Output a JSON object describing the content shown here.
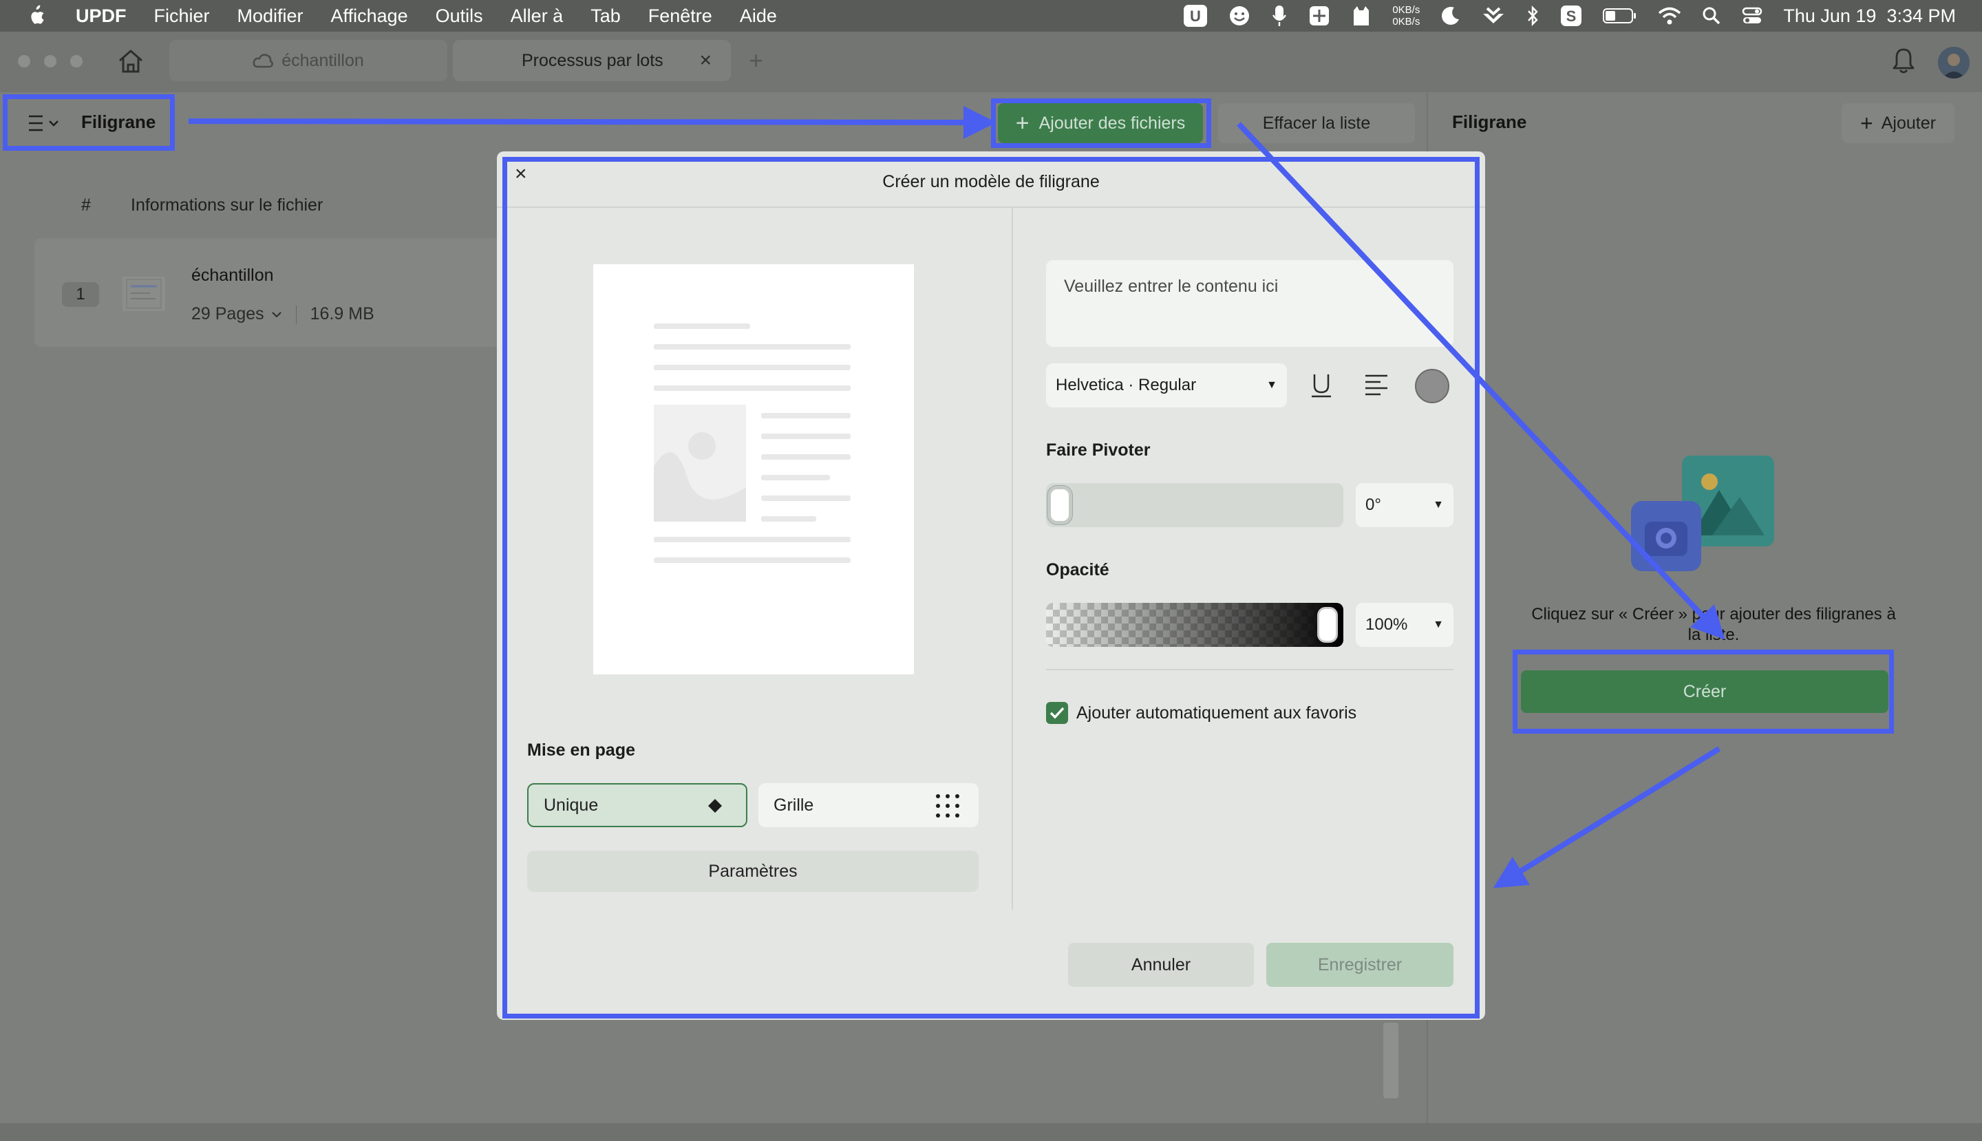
{
  "menubar": {
    "apple_icon": "apple-icon",
    "app_name": "UPDF",
    "items": [
      "Fichier",
      "Modifier",
      "Affichage",
      "Outils",
      "Aller à",
      "Tab",
      "Fenêtre",
      "Aide"
    ],
    "net_up": "0KB/s",
    "net_down": "0KB/s",
    "datetime": "Thu Jun 19  3:34 PM"
  },
  "tabs": {
    "doc_tab": "échantillon",
    "batch_tab": "Processus par lots"
  },
  "toolbar": {
    "mode_label": "Filigrane",
    "add_files": "Ajouter des fichiers",
    "clear_list": "Effacer la liste"
  },
  "file_list": {
    "col_num": "#",
    "col_info": "Informations sur le fichier",
    "rows": [
      {
        "index": "1",
        "name": "échantillon",
        "pages": "29 Pages",
        "size": "16.9 MB"
      }
    ]
  },
  "right_panel": {
    "title": "Filigrane",
    "add_label": "Ajouter",
    "empty_hint": "Cliquez sur « Créer » pour ajouter des filigranes à la liste.",
    "create_button": "Créer"
  },
  "modal": {
    "title": "Créer un modèle de filigrane",
    "text_placeholder": "Veuillez entrer le contenu ici",
    "font_value": "Helvetica · Regular",
    "rotate_label": "Faire Pivoter",
    "rotate_value": "0°",
    "rotate_fraction": 0.0,
    "opacity_label": "Opacité",
    "opacity_value": "100%",
    "opacity_fraction": 1.0,
    "auto_fav_label": "Ajouter automatiquement aux favoris",
    "auto_fav_checked": true,
    "layout_label": "Mise en page",
    "layout_unique": "Unique",
    "layout_grid": "Grille",
    "params_button": "Paramètres",
    "cancel_button": "Annuler",
    "save_button": "Enregistrer"
  },
  "colors": {
    "accent_green": "#3d7d4c",
    "annotation_blue": "#4a5ef0"
  }
}
